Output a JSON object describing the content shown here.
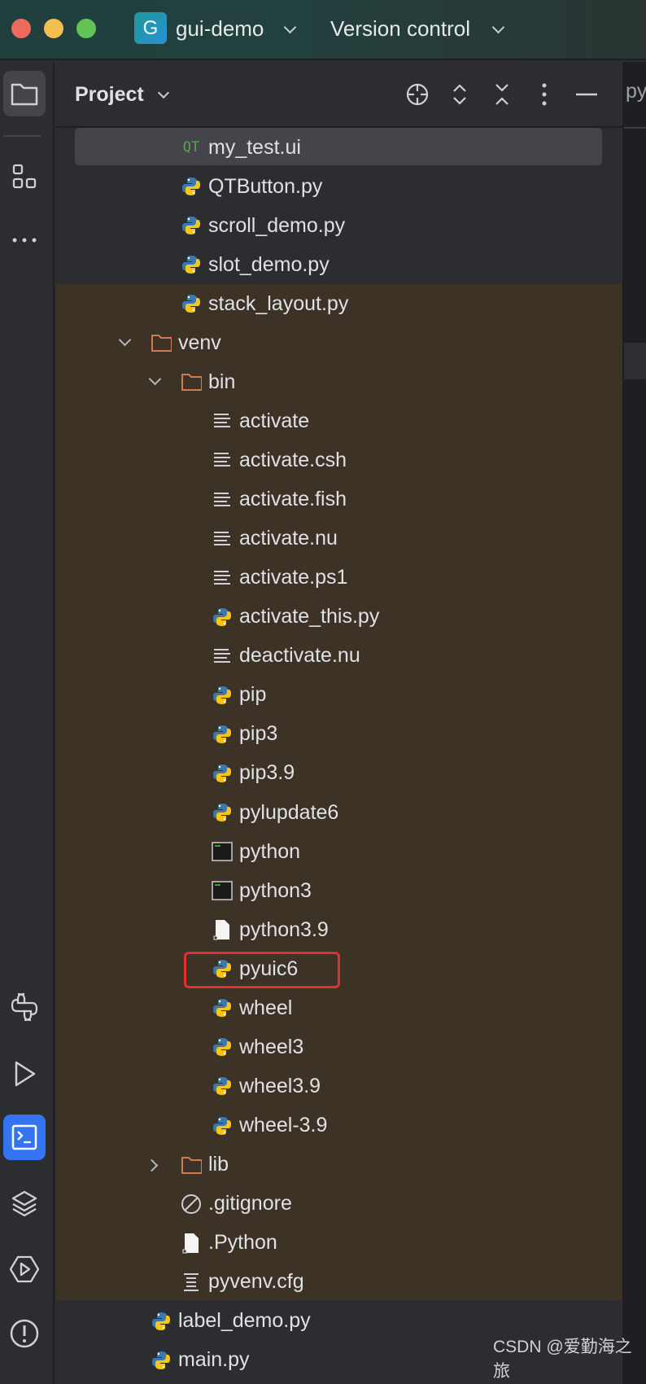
{
  "window": {
    "traffic_lights": [
      "#ee6a5f",
      "#f5bf4f",
      "#61c454"
    ],
    "project_badge": "G",
    "project_name": "gui-demo",
    "vcs_label": "Version control"
  },
  "left_toolbar": {
    "items": [
      "project-folder",
      "structure",
      "more",
      "python-console",
      "run",
      "terminal",
      "layers",
      "services",
      "problems"
    ],
    "active": [
      "project-folder",
      "terminal"
    ],
    "active_terminal_color": "#3574f0"
  },
  "panel": {
    "title": "Project",
    "header_icons": [
      "locate-icon",
      "expand-all-icon",
      "collapse-all-icon",
      "more-vertical-icon",
      "minimize-icon"
    ]
  },
  "editor_tab_fragment": "py",
  "tree": [
    {
      "label": "my_test.ui",
      "icon": "qt",
      "level": 2,
      "selected": true
    },
    {
      "label": "QTButton.py",
      "icon": "python",
      "level": 2
    },
    {
      "label": "scroll_demo.py",
      "icon": "python",
      "level": 2
    },
    {
      "label": "slot_demo.py",
      "icon": "python",
      "level": 2
    },
    {
      "label": "stack_layout.py",
      "icon": "python",
      "level": 2
    },
    {
      "label": "venv",
      "icon": "folder",
      "level": 1,
      "expanded": true
    },
    {
      "label": "bin",
      "icon": "folder",
      "level": 2,
      "expanded": true
    },
    {
      "label": "activate",
      "icon": "text",
      "level": 3
    },
    {
      "label": "activate.csh",
      "icon": "text",
      "level": 3
    },
    {
      "label": "activate.fish",
      "icon": "text",
      "level": 3
    },
    {
      "label": "activate.nu",
      "icon": "text",
      "level": 3
    },
    {
      "label": "activate.ps1",
      "icon": "text",
      "level": 3
    },
    {
      "label": "activate_this.py",
      "icon": "python",
      "level": 3
    },
    {
      "label": "deactivate.nu",
      "icon": "text",
      "level": 3
    },
    {
      "label": "pip",
      "icon": "python",
      "level": 3
    },
    {
      "label": "pip3",
      "icon": "python",
      "level": 3
    },
    {
      "label": "pip3.9",
      "icon": "python",
      "level": 3
    },
    {
      "label": "pylupdate6",
      "icon": "python",
      "level": 3
    },
    {
      "label": "python",
      "icon": "exec",
      "level": 3
    },
    {
      "label": "python3",
      "icon": "exec",
      "level": 3
    },
    {
      "label": "python3.9",
      "icon": "file",
      "level": 3
    },
    {
      "label": "pyuic6",
      "icon": "python",
      "level": 3,
      "highlighted": true
    },
    {
      "label": "wheel",
      "icon": "python",
      "level": 3
    },
    {
      "label": "wheel3",
      "icon": "python",
      "level": 3
    },
    {
      "label": "wheel3.9",
      "icon": "python",
      "level": 3
    },
    {
      "label": "wheel-3.9",
      "icon": "python",
      "level": 3
    },
    {
      "label": "lib",
      "icon": "folder",
      "level": 2,
      "expanded": false
    },
    {
      "label": ".gitignore",
      "icon": "ignore",
      "level": 2
    },
    {
      "label": ".Python",
      "icon": "file",
      "level": 2
    },
    {
      "label": "pyvenv.cfg",
      "icon": "cfg",
      "level": 2
    },
    {
      "label": "label_demo.py",
      "icon": "python",
      "level": 1
    },
    {
      "label": "main.py",
      "icon": "python",
      "level": 1
    }
  ],
  "colors": {
    "excluded_bg": "#3d3226",
    "selection_bg": "#43454a",
    "highlight_box": "#e0322a"
  },
  "watermark": "CSDN @爱勤海之旅"
}
